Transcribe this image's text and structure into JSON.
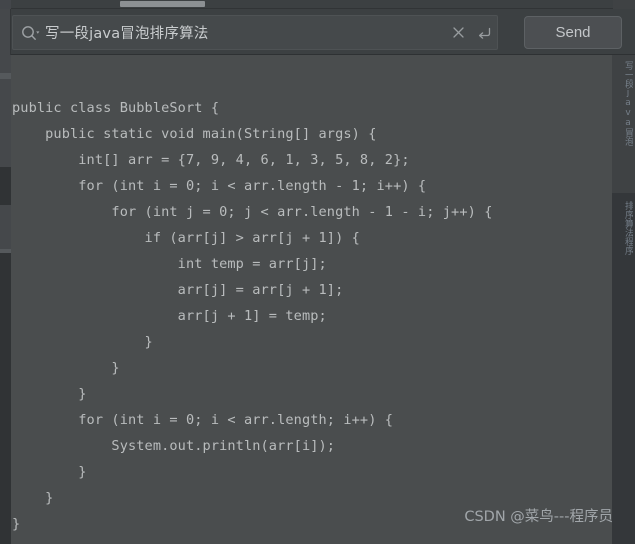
{
  "window": {
    "background_color": "#4a4d4e",
    "header_color": "#3c4042"
  },
  "header": {
    "search": {
      "value": "写一段java冒泡排序算法",
      "placeholder": "Search",
      "icon": "search-dropdown-icon",
      "clear_icon": "close-icon",
      "submit_icon": "enter-return-icon"
    },
    "send_button": {
      "label": "Send"
    }
  },
  "scrollbar": {
    "orientation": "horizontal",
    "thumb_color": "#8c9093"
  },
  "editor": {
    "language": "java",
    "text_color": "#b9bcbd",
    "code": "public class BubbleSort {\n    public static void main(String[] args) {\n        int[] arr = {7, 9, 4, 6, 1, 3, 5, 8, 2};\n        for (int i = 0; i < arr.length - 1; i++) {\n            for (int j = 0; j < arr.length - 1 - i; j++) {\n                if (arr[j] > arr[j + 1]) {\n                    int temp = arr[j];\n                    arr[j] = arr[j + 1];\n                    arr[j + 1] = temp;\n                }\n            }\n        }\n        for (int i = 0; i < arr.length; i++) {\n            System.out.println(arr[i]);\n        }\n    }\n}"
  },
  "right_gutter": {
    "vertical_text_top": "写一段java冒泡",
    "vertical_text_bottom": "排序算法程序"
  },
  "watermark": {
    "text": "CSDN @菜鸟---程序员"
  }
}
